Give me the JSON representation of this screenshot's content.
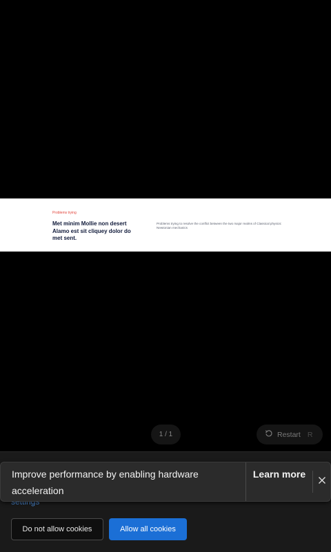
{
  "slide": {
    "eyebrow": "Problems trying",
    "heading": "Met minim Mollie non desert Alamo est sit cliquey dolor do met sent.",
    "body": "Problems trying to resolve the conflict between the two major realms of Classical physics: Newtonian mechanics"
  },
  "player": {
    "page_counter": "1 / 1",
    "restart_label": "Restart",
    "restart_key": "R"
  },
  "cookie_banner": {
    "settings_link": "settings",
    "deny_label": "Do not allow cookies",
    "allow_label": "Allow all cookies"
  },
  "notification": {
    "message": "Improve performance by enabling hardware acceleration",
    "learn_more": "Learn more"
  },
  "colors": {
    "accent": "#1b6fd6",
    "eyebrow": "#e2443b",
    "heading": "#101a3a"
  }
}
